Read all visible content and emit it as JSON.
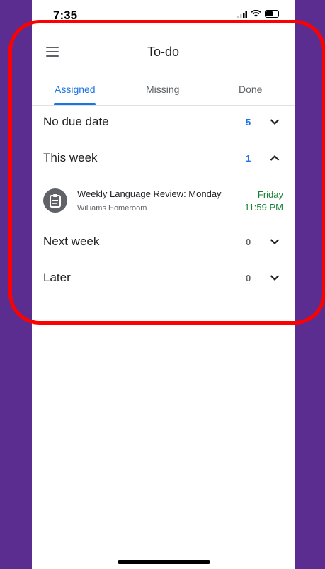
{
  "status_bar": {
    "time": "7:35"
  },
  "app_bar": {
    "title": "To-do",
    "menu_icon": "hamburger-menu-icon"
  },
  "tabs": [
    {
      "label": "Assigned",
      "active": true
    },
    {
      "label": "Missing",
      "active": false
    },
    {
      "label": "Done",
      "active": false
    }
  ],
  "sections": [
    {
      "title": "No due date",
      "count": "5",
      "expanded": false
    },
    {
      "title": "This week",
      "count": "1",
      "expanded": true
    },
    {
      "title": "Next week",
      "count": "0",
      "expanded": false
    },
    {
      "title": "Later",
      "count": "0",
      "expanded": false
    }
  ],
  "assignments": [
    {
      "title": "Weekly Language Review: Monday",
      "class": "Williams Homeroom",
      "due_day": "Friday",
      "due_time": "11:59 PM",
      "icon": "assignment-icon"
    }
  ],
  "colors": {
    "background": "#5b2d91",
    "accent": "#1a73e8",
    "due_green": "#188038",
    "highlight": "#ff0000"
  }
}
